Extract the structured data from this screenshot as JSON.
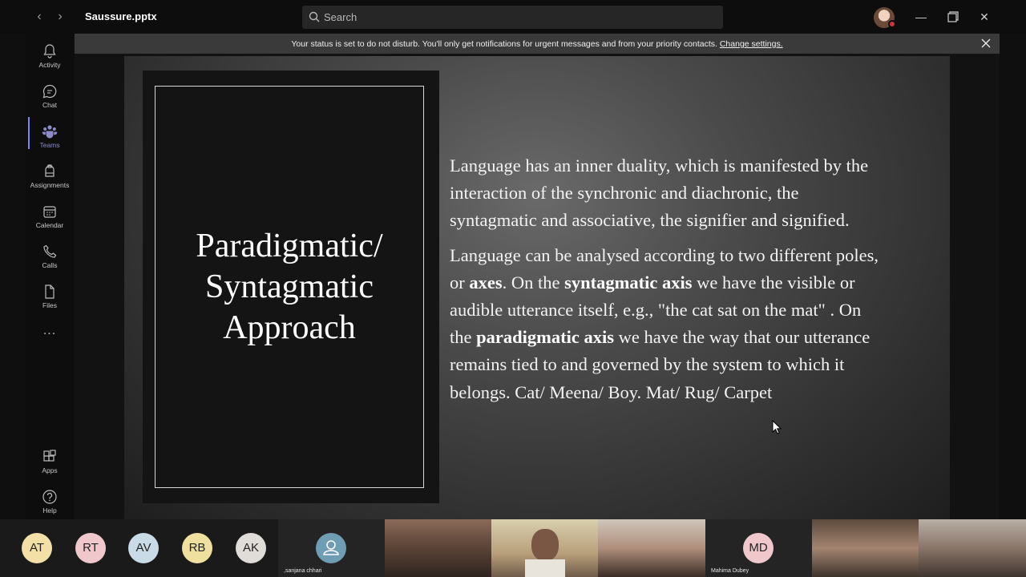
{
  "window": {
    "doc_title": "Saussure.pptx",
    "search_placeholder": "Search"
  },
  "rail": {
    "items": [
      {
        "label": "Activity",
        "icon": "bell-icon"
      },
      {
        "label": "Chat",
        "icon": "chat-icon"
      },
      {
        "label": "Teams",
        "icon": "teams-icon",
        "active": true
      },
      {
        "label": "Assignments",
        "icon": "assignments-icon"
      },
      {
        "label": "Calendar",
        "icon": "calendar-icon"
      },
      {
        "label": "Calls",
        "icon": "phone-icon"
      },
      {
        "label": "Files",
        "icon": "file-icon"
      }
    ],
    "more": "...",
    "bottom_items": [
      {
        "label": "Apps",
        "icon": "apps-icon"
      },
      {
        "label": "Help",
        "icon": "help-icon"
      }
    ]
  },
  "banner": {
    "text": "Your status is set to do not disturb. You'll only get notifications for urgent messages and from your priority contacts.",
    "link": "Change settings."
  },
  "slide": {
    "title_line1": "Paradigmatic/",
    "title_line2": "Syntagmatic",
    "title_line3": "Approach",
    "para1": "Language has an inner duality, which is manifested by the interaction of the synchronic and diachronic, the syntagmatic and associative, the signifier and signified.",
    "para2": {
      "t1": "Language can be analysed according to two different poles, or ",
      "b1": "axes",
      "t2": ". On the ",
      "b2": "syntagmatic axis",
      "t3": " we have the visible or audible utterance itself, e.g., \"the cat sat on the mat\" . On the ",
      "b3": "paradigmatic axis",
      "t4": " we have the way that our utterance remains tied to and governed by the system to which it belongs. Cat/ Meena/ Boy. Mat/ Rug/ Carpet"
    }
  },
  "participants": {
    "initials": [
      {
        "text": "AT",
        "color": "#f2e0a6"
      },
      {
        "text": "RT",
        "color": "#f0c8cc"
      },
      {
        "text": "AV",
        "color": "#c9dbe6"
      },
      {
        "text": "RB",
        "color": "#efe0a0"
      },
      {
        "text": "AK",
        "color": "#e0dcd8"
      }
    ],
    "tile_names": {
      "sanjana": ",sanjana chhari",
      "mahima": "Mahima Dubey",
      "mahima_initials": "MD"
    }
  },
  "colors": {
    "accent": "#7f85f5",
    "dnd": "#d13438"
  }
}
